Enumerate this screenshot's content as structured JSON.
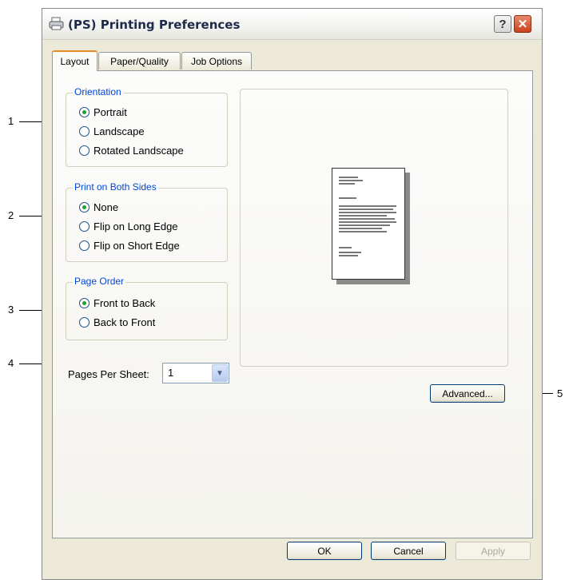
{
  "window": {
    "title": "(PS) Printing Preferences",
    "help_label": "?",
    "close_label": "✕"
  },
  "tabs": [
    {
      "label": "Layout",
      "active": true
    },
    {
      "label": "Paper/Quality",
      "active": false
    },
    {
      "label": "Job Options",
      "active": false
    }
  ],
  "orientation": {
    "legend": "Orientation",
    "options": [
      {
        "label": "Portrait",
        "checked": true
      },
      {
        "label": "Landscape",
        "checked": false
      },
      {
        "label": "Rotated Landscape",
        "checked": false
      }
    ]
  },
  "both_sides": {
    "legend": "Print on Both Sides",
    "options": [
      {
        "label": "None",
        "checked": true
      },
      {
        "label": "Flip on Long Edge",
        "checked": false
      },
      {
        "label": "Flip on Short Edge",
        "checked": false
      }
    ]
  },
  "page_order": {
    "legend": "Page Order",
    "options": [
      {
        "label": "Front to Back",
        "checked": true
      },
      {
        "label": "Back to Front",
        "checked": false
      }
    ]
  },
  "pages_per_sheet": {
    "label": "Pages Per Sheet:",
    "value": "1"
  },
  "buttons": {
    "advanced": "Advanced...",
    "ok": "OK",
    "cancel": "Cancel",
    "apply": "Apply"
  },
  "callouts": [
    "1",
    "2",
    "3",
    "4",
    "5"
  ]
}
